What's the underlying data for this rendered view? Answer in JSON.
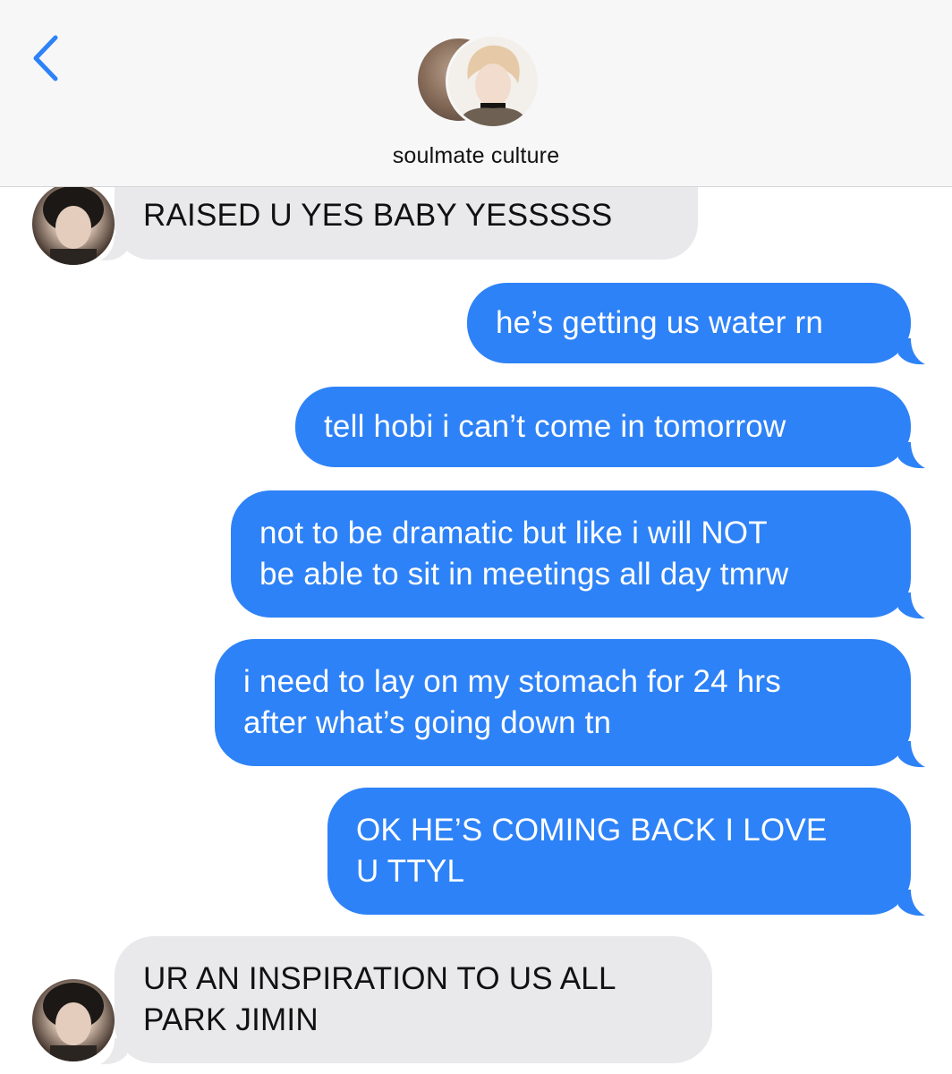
{
  "header": {
    "back_icon": "chevron-left-icon",
    "contact_name": "soulmate culture",
    "accent_color": "#2e82f7"
  },
  "messages": [
    {
      "direction": "incoming",
      "lines": [
        "RAISED U YES BABY YESSSSS"
      ]
    },
    {
      "direction": "outgoing",
      "lines": [
        "he’s getting us water rn"
      ]
    },
    {
      "direction": "outgoing",
      "lines": [
        "tell hobi i can’t come in tomorrow"
      ]
    },
    {
      "direction": "outgoing",
      "lines": [
        "not to be dramatic but like i will NOT",
        "be able to sit in meetings all day tmrw"
      ]
    },
    {
      "direction": "outgoing",
      "lines": [
        "i need to lay on my stomach for 24 hrs",
        "after what’s going down tn"
      ]
    },
    {
      "direction": "outgoing",
      "lines": [
        "OK HE’S COMING BACK I LOVE",
        "U TTYL"
      ]
    },
    {
      "direction": "incoming",
      "lines": [
        "UR AN INSPIRATION TO US ALL",
        "PARK JIMIN"
      ]
    }
  ],
  "colors": {
    "incoming_bubble": "#e9e9eb",
    "outgoing_bubble": "#2e82f7",
    "header_bg": "#f7f7f7"
  }
}
